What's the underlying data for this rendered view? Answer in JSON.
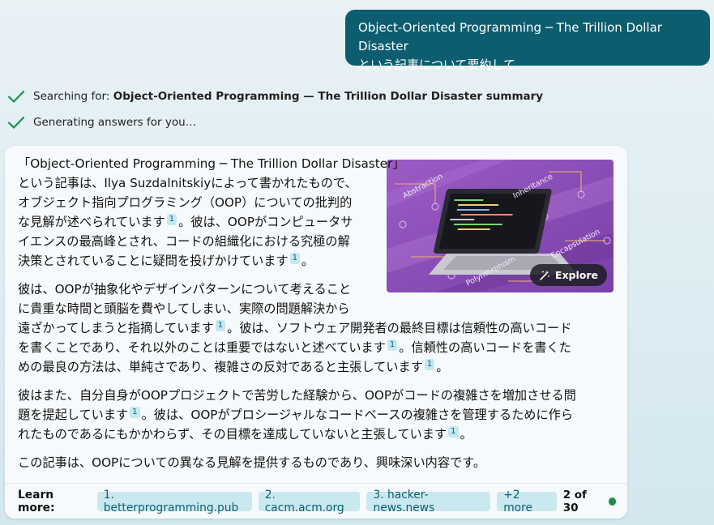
{
  "user_message": {
    "line1": "Object-Oriented Programming ─ The Trillion Dollar Disaster",
    "line2": "という記事について要約して"
  },
  "status": {
    "searching_prefix": "Searching for: ",
    "searching_query": "Object-Oriented Programming — The Trillion Dollar Disaster summary",
    "generating": "Generating answers for you…",
    "check_icon": "check-icon",
    "check_color": "#1a8f4c"
  },
  "answer": {
    "p1": [
      "「Object-Oriented Programming ─ The Trillion Dollar Disaster」",
      "という記事は、Ilya Suzdalnitskiyによって書かれたもので、",
      "オブジェクト指向プログラミング（OOP）についての批判的",
      "な見解が述べられています",
      "。彼は、OOPがコンピュータサ",
      "イエンスの最高峰とされ、コードの組織化における究極の解",
      "決策とされていることに疑問を投げかけています",
      "。"
    ],
    "p2": [
      "彼は、OOPが抽象化やデザインパターンについて考えること",
      "に貴重な時間と頭脳を費やしてしまい、実際の問題解決から",
      "遠ざかってしまうと指摘しています",
      "。彼は、ソフトウェア開発者の最終目標は信頼性の高いコード",
      "を書くことであり、それ以外のことは重要ではないと述べています",
      "。信頼性の高いコードを書くた",
      "めの最良の方法は、単純さであり、複雑さの反対であると主張しています",
      "。"
    ],
    "p3": [
      "彼はまた、自分自身がOOPプロジェクトで苦労した経験から、OOPがコードの複雑さを増加させる問",
      "題を提起しています",
      "。彼は、OOPがプロシージャルなコードベースの複雑さを管理するために作ら",
      "れたものであるにもかかわらず、その目標を達成していないと主張しています",
      "。"
    ],
    "p4": "この記事は、OOPについての異なる見解を提供するものであり、興味深い内容です。",
    "citation": "1"
  },
  "hero": {
    "labels": [
      "Abstraction",
      "Inheritance",
      "Encapsulation",
      "Polymorphism"
    ],
    "explore_label": "Explore",
    "explore_icon": "magic-wand-icon",
    "bg_color": "#8a4fb5"
  },
  "footer": {
    "learn_more": "Learn more:",
    "sources": [
      "1. betterprogramming.pub",
      "2. cacm.acm.org",
      "3. hacker-news.news"
    ],
    "more": "+2 more",
    "count": "2 of 30",
    "status_color": "#1a8f4c"
  }
}
